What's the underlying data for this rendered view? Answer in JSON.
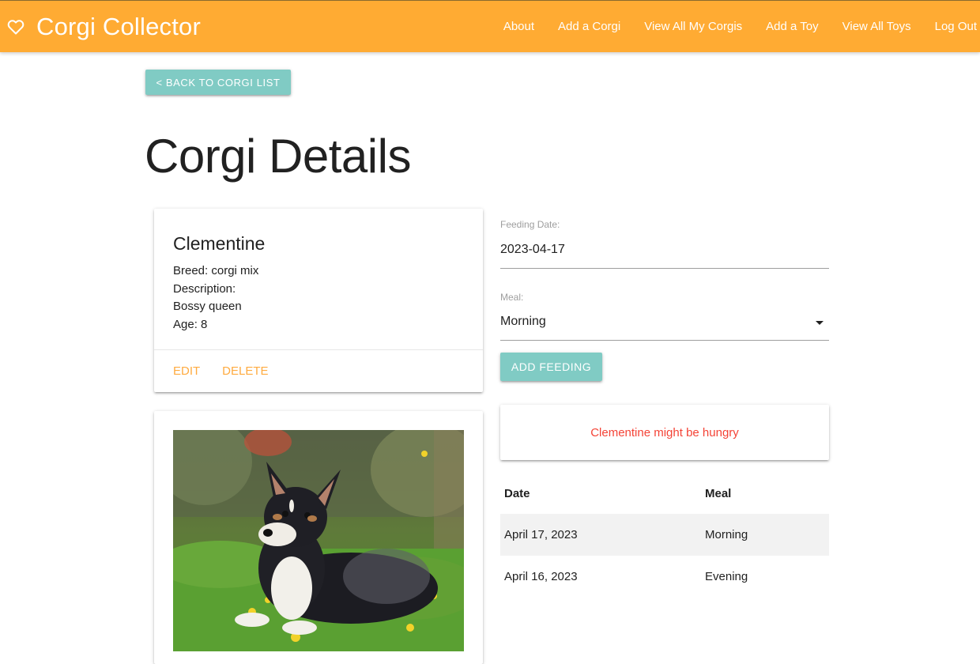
{
  "nav": {
    "brand": "Corgi Collector",
    "brand_icon": "heart-icon",
    "links": [
      "About",
      "Add a Corgi",
      "View All My Corgis",
      "Add a Toy",
      "View All Toys",
      "Log Out"
    ],
    "color": "#ffab33"
  },
  "back_button": "< BACK TO CORGI LIST",
  "page_title": "Corgi Details",
  "corgi": {
    "name": "Clementine",
    "breed": "Breed: corgi mix",
    "description_label": "Description:",
    "description": "Bossy queen",
    "age": "Age: 8",
    "edit_label": "EDIT",
    "delete_label": "DELETE"
  },
  "feeding_form": {
    "date_label": "Feeding Date:",
    "date_value": "2023-04-17",
    "meal_label": "Meal:",
    "meal_value": "Morning",
    "submit_label": "ADD FEEDING"
  },
  "hungry_message": "Clementine might be hungry",
  "feedings": {
    "headers": [
      "Date",
      "Meal"
    ],
    "rows": [
      {
        "date": "April 17, 2023",
        "meal": "Morning"
      },
      {
        "date": "April 16, 2023",
        "meal": "Evening"
      }
    ]
  },
  "colors": {
    "accent": "#80cbc4",
    "action": "#ffab40",
    "warning": "#f44336"
  }
}
